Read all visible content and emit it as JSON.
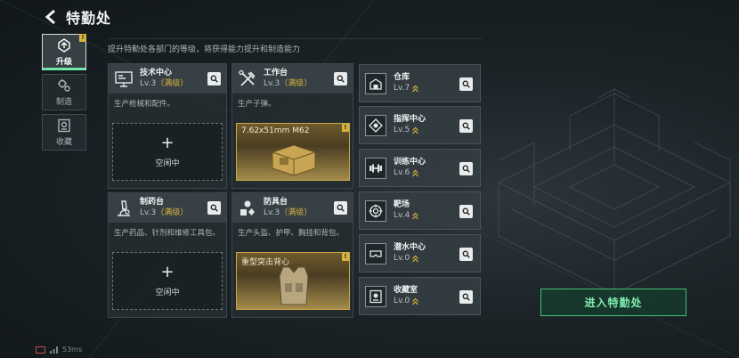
{
  "header": {
    "title": "特勤处",
    "back_icon": "back-arrow-icon"
  },
  "sidebar": {
    "tabs": [
      {
        "label": "升级",
        "icon": "upgrade-icon",
        "active": true,
        "badge": "!"
      },
      {
        "label": "制造",
        "icon": "gears-icon",
        "active": false
      },
      {
        "label": "收藏",
        "icon": "collection-icon",
        "active": false
      }
    ]
  },
  "description": "提升特勤处各部门的等级，将获得能力提升和制造能力",
  "workshops": [
    {
      "name": "技术中心",
      "level": "Lv.3",
      "max_tag": "（满级）",
      "desc": "生产枪械和配件。",
      "slot_type": "idle",
      "slot_text": "空闲中",
      "icon": "monitor-icon"
    },
    {
      "name": "工作台",
      "level": "Lv.3",
      "max_tag": "（满级）",
      "desc": "生产子弹。",
      "slot_type": "product",
      "product_name": "7.62x51mm M62",
      "product_badge": "!",
      "icon": "hammer-wrench-icon"
    },
    {
      "name": "制药台",
      "level": "Lv.3",
      "max_tag": "（满级）",
      "desc": "生产药品、针剂和维修工具包。",
      "slot_type": "idle",
      "slot_text": "空闲中",
      "icon": "microscope-icon"
    },
    {
      "name": "防具台",
      "level": "Lv.3",
      "max_tag": "（满级）",
      "desc": "生产头盔、护甲、胸挂和背包。",
      "slot_type": "product",
      "product_name": "重型突击背心",
      "product_badge": "!",
      "icon": "armor-parts-icon"
    }
  ],
  "facilities": [
    {
      "name": "仓库",
      "level": "Lv.7",
      "icon": "warehouse-icon"
    },
    {
      "name": "指挥中心",
      "level": "Lv.5",
      "icon": "command-icon"
    },
    {
      "name": "训练中心",
      "level": "Lv.6",
      "icon": "dumbbell-icon"
    },
    {
      "name": "靶场",
      "level": "Lv.4",
      "icon": "target-icon"
    },
    {
      "name": "潜水中心",
      "level": "Lv.0",
      "icon": "diving-mask-icon"
    },
    {
      "name": "收藏室",
      "level": "Lv.0",
      "icon": "vault-icon"
    }
  ],
  "enter_button": {
    "label": "进入特勤处"
  },
  "status": {
    "ping": "53ms"
  },
  "colors": {
    "accent_green": "#6fe7a8",
    "gold": "#d6b23f",
    "panel": "#2c363a"
  }
}
